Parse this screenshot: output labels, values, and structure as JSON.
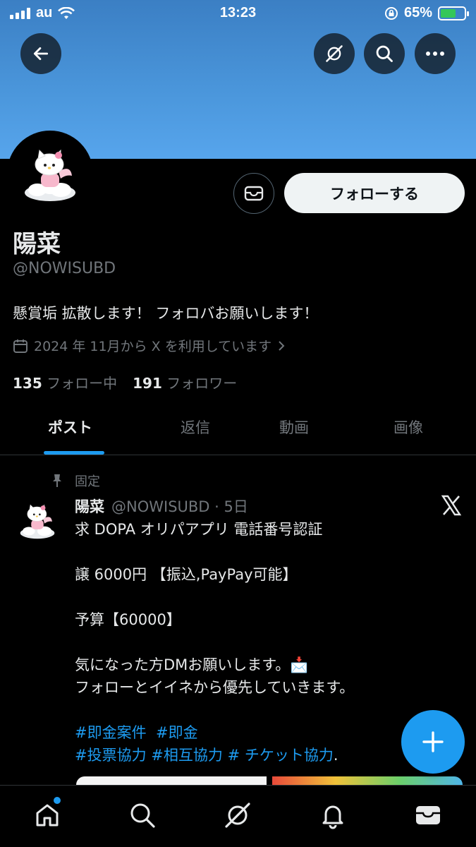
{
  "status_bar": {
    "carrier": "au",
    "time": "13:23",
    "battery": "65%",
    "battery_level": 0.65
  },
  "profile": {
    "name": "陽菜",
    "handle": "@NOWISUBD",
    "bio": "懸賞垢 拡散します！ フォロバお願いします！",
    "joined": "2024 年 11月から X を利用しています",
    "following_count": "135",
    "following_label": "フォロー中",
    "followers_count": "191",
    "followers_label": "フォロワー",
    "follow_button": "フォローする"
  },
  "tabs": [
    "ポスト",
    "返信",
    "動画",
    "画像"
  ],
  "pinned_post": {
    "pinned_label": "固定",
    "author_name": "陽菜",
    "author_meta": "@NOWISUBD · 5日",
    "lines": [
      "求 DOPA オリパアプリ 電話番号認証",
      "",
      "譲 6000円 【振込,PayPay可能】",
      "",
      "予算【60000】",
      "",
      "気になった方DMお願いします。📩",
      "フォローとイイネから優先していきます。",
      ""
    ],
    "hashtags_line1": [
      "#即金案件",
      "#即金"
    ],
    "hashtags_line2": [
      "#投票協力",
      "#相互協力",
      "# チケット協力"
    ],
    "hashtags_line2_suffix": "."
  },
  "colors": {
    "accent": "#1d9bf0",
    "banner": "#4b97dc",
    "background": "#000000"
  },
  "icons": {
    "top": [
      "back-arrow-icon",
      "grok-icon",
      "search-icon",
      "more-icon"
    ],
    "nav": [
      "home-icon",
      "search-icon",
      "grok-icon",
      "bell-icon",
      "mail-icon"
    ]
  }
}
